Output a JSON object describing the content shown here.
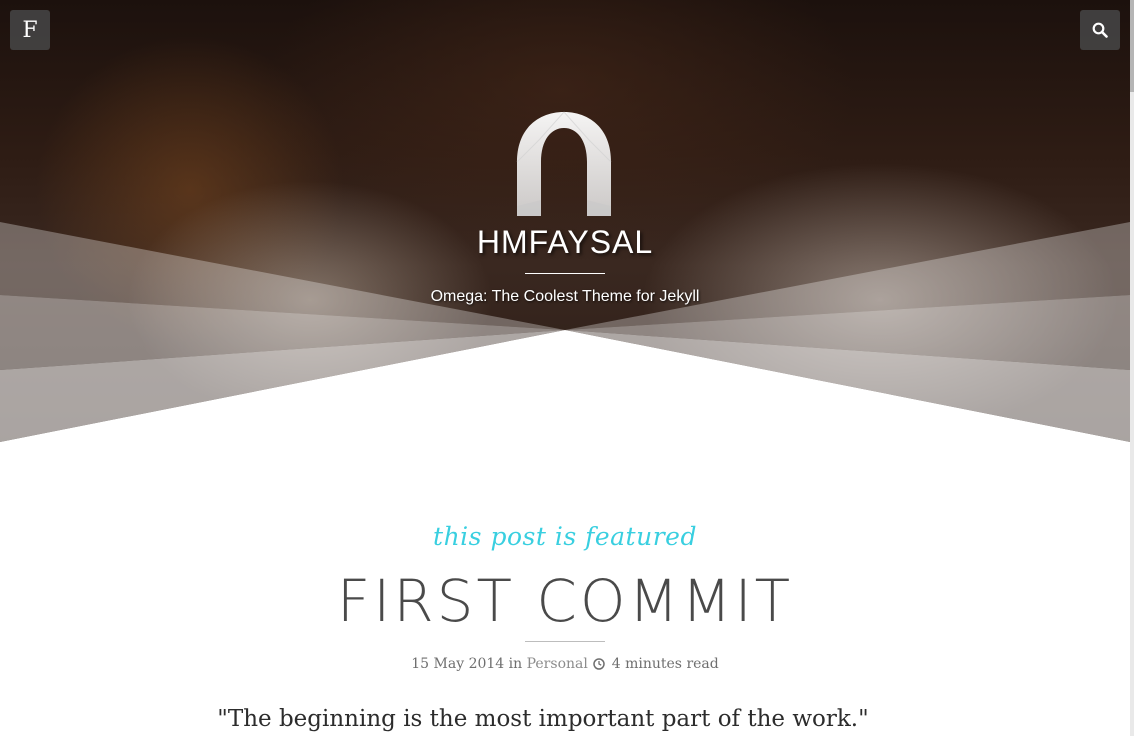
{
  "header": {
    "menu_label": "F",
    "site_title": "HMFAYSAL",
    "tagline": "Omega: The Coolest Theme for Jekyll",
    "logo_icon": "omega-logo-icon",
    "search_icon": "search-icon"
  },
  "post": {
    "featured_label": "this post is featured",
    "title": "FIRST COMMIT",
    "date": "15 May 2014",
    "in_word": "in",
    "category": "Personal",
    "read_time": "4 minutes read",
    "quote": "\"The beginning is the most important part of the work.\""
  },
  "colors": {
    "accent": "#39cfe0",
    "title_text": "#4a4a4a",
    "meta_text": "#6f6f6f"
  }
}
